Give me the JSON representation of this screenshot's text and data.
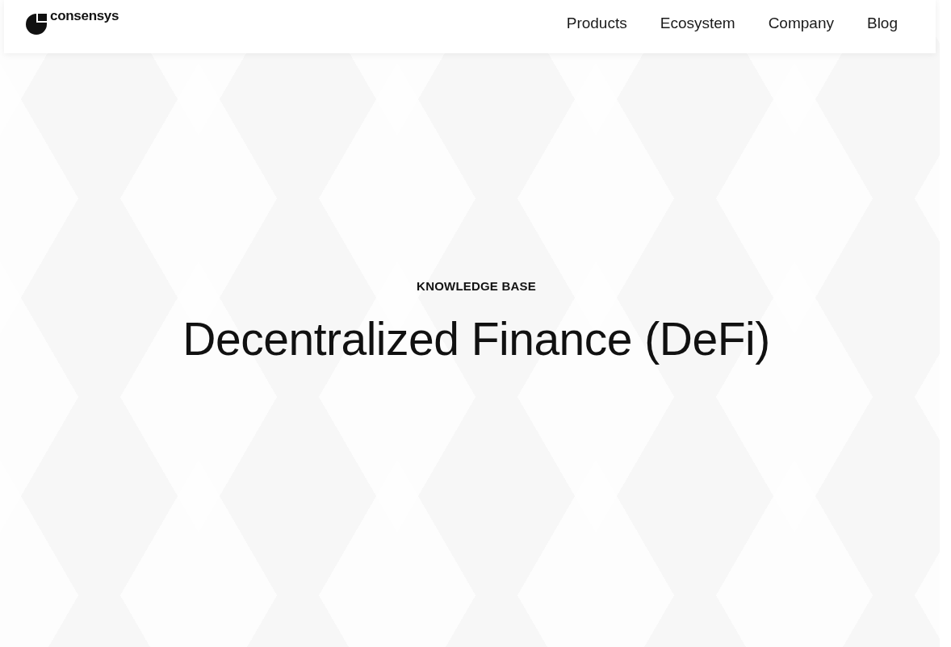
{
  "header": {
    "logo_text": "consensys",
    "nav": [
      {
        "label": "Products"
      },
      {
        "label": "Ecosystem"
      },
      {
        "label": "Company"
      },
      {
        "label": "Blog"
      }
    ]
  },
  "hero": {
    "eyebrow": "KNOWLEDGE BASE",
    "title": "Decentralized Finance (DeFi)"
  }
}
